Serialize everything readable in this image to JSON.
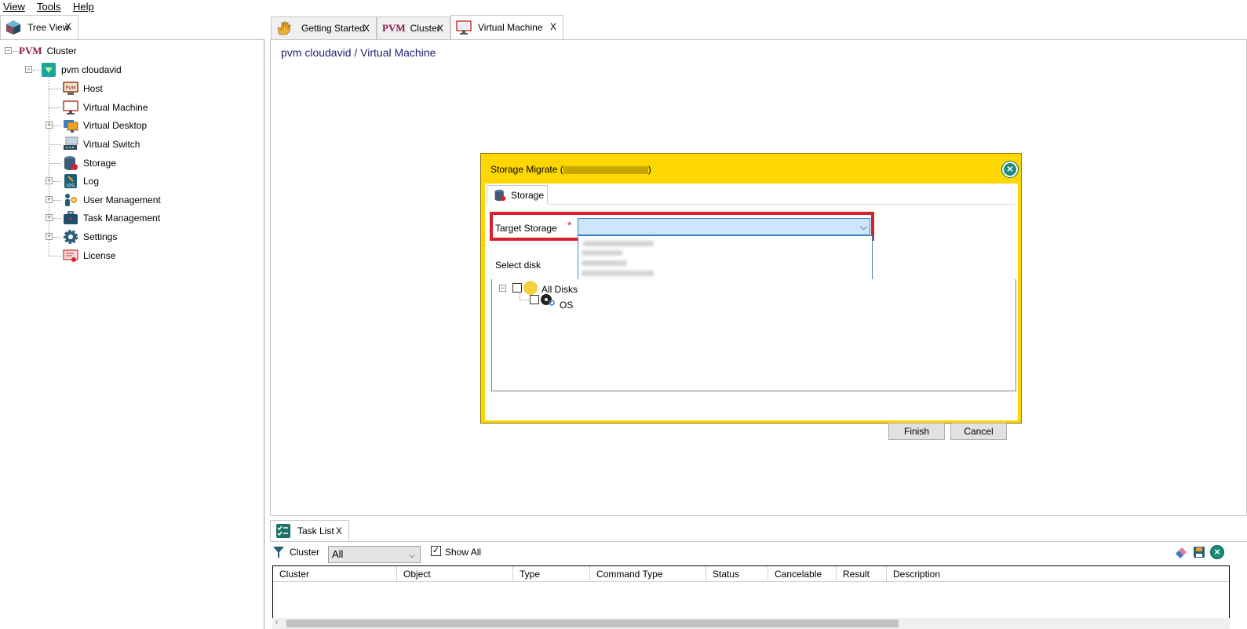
{
  "menu": {
    "items": [
      "View",
      "Tools",
      "Help"
    ]
  },
  "tree_view_tab": {
    "label": "Tree View",
    "close": "X"
  },
  "doc_tabs": [
    {
      "label": "Getting Started",
      "close": "X",
      "icon": "hand-icon"
    },
    {
      "label": "Cluster",
      "close": "X",
      "icon": "pvm-logo-icon"
    },
    {
      "label": "Virtual Machine",
      "close": "X",
      "icon": "monitor-icon"
    }
  ],
  "tree": {
    "root": "Cluster",
    "root_logo": "PVM",
    "node": "pvm cloudavid",
    "items": [
      {
        "label": "Host",
        "icon": "host-icon",
        "expandable": false
      },
      {
        "label": "Virtual Machine",
        "icon": "monitor-icon",
        "expandable": false
      },
      {
        "label": "Virtual Desktop",
        "icon": "desktop-icon",
        "expandable": true
      },
      {
        "label": "Virtual Switch",
        "icon": "switch-icon",
        "expandable": false
      },
      {
        "label": "Storage",
        "icon": "storage-icon",
        "expandable": false
      },
      {
        "label": "Log",
        "icon": "log-icon",
        "expandable": true
      },
      {
        "label": "User Management",
        "icon": "users-icon",
        "expandable": true
      },
      {
        "label": "Task Management",
        "icon": "briefcase-icon",
        "expandable": true
      },
      {
        "label": "Settings",
        "icon": "gear-icon",
        "expandable": true
      },
      {
        "label": "License",
        "icon": "certificate-icon",
        "expandable": false
      }
    ]
  },
  "breadcrumb": "pvm cloudavid / Virtual Machine",
  "dialog": {
    "title_prefix": "Storage Migrate (",
    "title_suffix": ")",
    "tab_label": "Storage",
    "target_storage_label": "Target Storage",
    "required_mark": "*",
    "target_storage_value": "",
    "select_disk_label": "Select disk",
    "disks": {
      "all_label": "All Disks",
      "children": [
        "OS"
      ]
    },
    "finish_label": "Finish",
    "cancel_label": "Cancel"
  },
  "task_list": {
    "tab_label": "Task List",
    "close": "X",
    "filter_label": "Cluster",
    "filter_value": "All",
    "show_all_label": "Show All",
    "show_all_checked": true,
    "columns": [
      "Cluster",
      "Object",
      "Type",
      "Command Type",
      "Status",
      "Cancelable",
      "Result",
      "Description"
    ]
  },
  "colors": {
    "dialog_bg": "#ffd700",
    "highlight": "#d6202a",
    "select_bg": "#cde6fb",
    "breadcrumb": "#1f1f6e"
  }
}
